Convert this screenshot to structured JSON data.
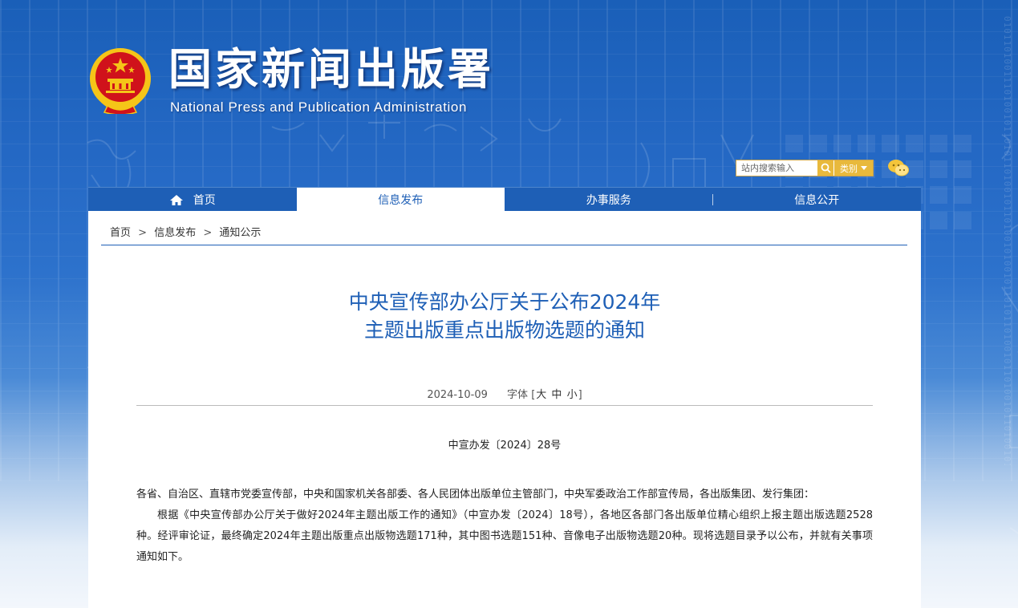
{
  "site": {
    "title": "国家新闻出版署",
    "subtitle": "National Press and Publication Administration"
  },
  "search": {
    "placeholder": "站内搜索输入",
    "category_label": "类别"
  },
  "nav": {
    "items": [
      {
        "label": "首页",
        "icon": "home-icon"
      },
      {
        "label": "信息发布",
        "active": true
      },
      {
        "label": "办事服务"
      },
      {
        "label": "信息公开"
      }
    ]
  },
  "breadcrumb": {
    "items": [
      "首页",
      "信息发布",
      "通知公示"
    ],
    "separator": ">"
  },
  "article": {
    "title_line1": "中央宣传部办公厅关于公布2024年",
    "title_line2": "主题出版重点出版物选题的通知",
    "date": "2024-10-09",
    "font_label": "字体",
    "font_open": "[",
    "font_sizes": [
      "大",
      "中",
      "小"
    ],
    "font_close": "]",
    "doc_number": "中宣办发〔2024〕28号",
    "paragraph1": "各省、自治区、直辖市党委宣传部，中央和国家机关各部委、各人民团体出版单位主管部门，中央军委政治工作部宣传局，各出版集团、发行集团：",
    "paragraph2": "根据《中央宣传部办公厅关于做好2024年主题出版工作的通知》（中宣办发〔2024〕18号），各地区各部门各出版单位精心组织上报主题出版选题2528种。经评审论证，最终确定2024年主题出版重点出版物选题171种，其中图书选题151种、音像电子出版物选题20种。现将选题目录予以公布，并就有关事项通知如下。"
  },
  "colors": {
    "primary_blue": "#1e5fb6",
    "search_gold": "#e8b93c",
    "emblem_red": "#d0121b",
    "emblem_gold": "#f5c518"
  }
}
